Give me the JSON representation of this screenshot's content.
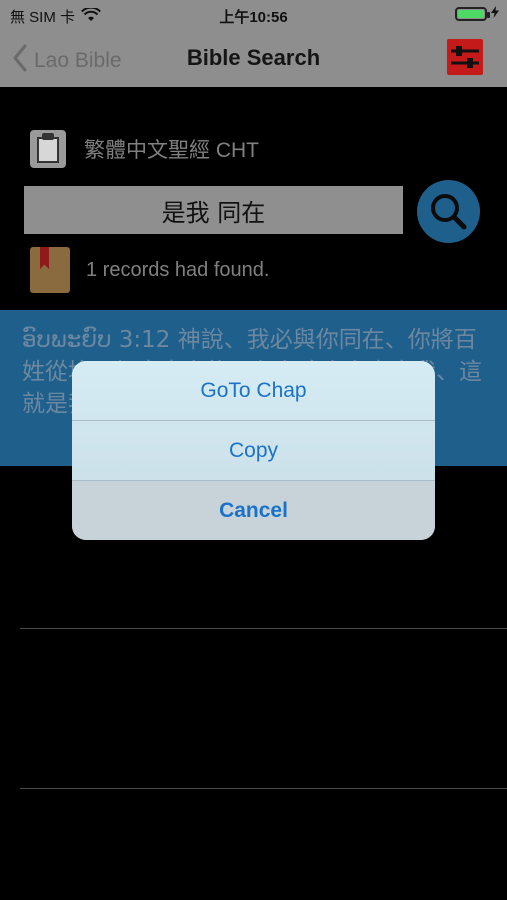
{
  "status_bar": {
    "carrier": "無 SIM 卡",
    "time": "上午10:56"
  },
  "nav": {
    "back_label": "Lao Bible",
    "title": "Bible Search"
  },
  "version": {
    "label": "繁體中文聖經 CHT"
  },
  "search": {
    "query": "是我 同在"
  },
  "results": {
    "summary": "1 records had found."
  },
  "verse": {
    "text": "ອົບພະຍົບ 3:12 神說、我必與你同在、你將百姓從埃及領出來之後、必在這山上事奉我、這就是我打發你去的證據。"
  },
  "action_sheet": {
    "items": [
      {
        "label": "GoTo Chap"
      },
      {
        "label": "Copy"
      },
      {
        "label": "Cancel"
      }
    ]
  },
  "colors": {
    "accent": "#1f5f8c",
    "action_text": "#1a73c8",
    "settings_icon_bg": "#c41a1a"
  },
  "icons": {
    "back": "chevron-left-icon",
    "settings": "sliders-icon",
    "version": "clipboard-icon",
    "search": "search-icon",
    "results": "book-icon"
  }
}
